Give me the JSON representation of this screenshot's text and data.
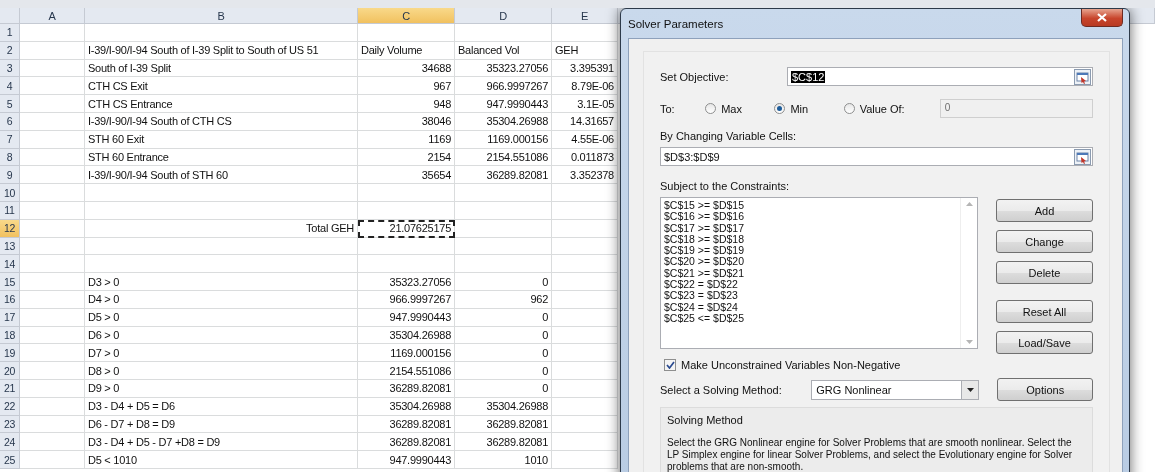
{
  "sheet": {
    "columns": [
      {
        "label": "A",
        "selected": false
      },
      {
        "label": "B",
        "selected": false
      },
      {
        "label": "C",
        "selected": true
      },
      {
        "label": "D",
        "selected": false
      },
      {
        "label": "E",
        "selected": false
      }
    ],
    "rows": [
      {
        "number": "1",
        "selected": false,
        "kind": "data",
        "cells": {}
      },
      {
        "number": "2",
        "selected": false,
        "kind": "header",
        "cells": {
          "b": "I-39/I-90/I-94 South of I-39 Split to South of US 51",
          "c": "Daily Volume",
          "d": "Balanced Vol",
          "e": "GEH"
        }
      },
      {
        "number": "3",
        "selected": false,
        "kind": "data",
        "cells": {
          "b": "South of I-39 Split",
          "c": "34688",
          "d": "35323.27056",
          "e": "3.395391"
        }
      },
      {
        "number": "4",
        "selected": false,
        "kind": "data",
        "cells": {
          "b": "CTH CS Exit",
          "c": "967",
          "d": "966.9997267",
          "e": "8.79E-06"
        }
      },
      {
        "number": "5",
        "selected": false,
        "kind": "data",
        "cells": {
          "b": "CTH CS Entrance",
          "c": "948",
          "d": "947.9990443",
          "e": "3.1E-05"
        }
      },
      {
        "number": "6",
        "selected": false,
        "kind": "data",
        "cells": {
          "b": "I-39/I-90/I-94 South of CTH CS",
          "c": "38046",
          "d": "35304.26988",
          "e": "14.31657"
        }
      },
      {
        "number": "7",
        "selected": false,
        "kind": "data",
        "cells": {
          "b": "STH 60 Exit",
          "c": "1169",
          "d": "1169.000156",
          "e": "4.55E-06"
        }
      },
      {
        "number": "8",
        "selected": false,
        "kind": "data",
        "cells": {
          "b": "STH 60 Entrance",
          "c": "2154",
          "d": "2154.551086",
          "e": "0.011873"
        }
      },
      {
        "number": "9",
        "selected": false,
        "kind": "data",
        "cells": {
          "b": "I-39/I-90/I-94 South of STH 60",
          "c": "35654",
          "d": "36289.82081",
          "e": "3.352378"
        }
      },
      {
        "number": "10",
        "selected": false,
        "kind": "data",
        "cells": {}
      },
      {
        "number": "11",
        "selected": false,
        "kind": "data",
        "cells": {}
      },
      {
        "number": "12",
        "selected": true,
        "kind": "total",
        "cells": {
          "b": "Total GEH",
          "c": "21.07625175"
        }
      },
      {
        "number": "13",
        "selected": false,
        "kind": "data",
        "cells": {}
      },
      {
        "number": "14",
        "selected": false,
        "kind": "data",
        "cells": {}
      },
      {
        "number": "15",
        "selected": false,
        "kind": "data",
        "cells": {
          "b": "D3 > 0",
          "c": "35323.27056",
          "d": "0"
        }
      },
      {
        "number": "16",
        "selected": false,
        "kind": "data",
        "cells": {
          "b": "D4 > 0",
          "c": "966.9997267",
          "d": "962"
        }
      },
      {
        "number": "17",
        "selected": false,
        "kind": "data",
        "cells": {
          "b": "D5 > 0",
          "c": "947.9990443",
          "d": "0"
        }
      },
      {
        "number": "18",
        "selected": false,
        "kind": "data",
        "cells": {
          "b": "D6 > 0",
          "c": "35304.26988",
          "d": "0"
        }
      },
      {
        "number": "19",
        "selected": false,
        "kind": "data",
        "cells": {
          "b": "D7 > 0",
          "c": "1169.000156",
          "d": "0"
        }
      },
      {
        "number": "20",
        "selected": false,
        "kind": "data",
        "cells": {
          "b": "D8 > 0",
          "c": "2154.551086",
          "d": "0"
        }
      },
      {
        "number": "21",
        "selected": false,
        "kind": "data",
        "cells": {
          "b": "D9 > 0",
          "c": "36289.82081",
          "d": "0"
        }
      },
      {
        "number": "22",
        "selected": false,
        "kind": "data",
        "cells": {
          "b": "D3 - D4 + D5 = D6",
          "c": "35304.26988",
          "d": "35304.26988"
        }
      },
      {
        "number": "23",
        "selected": false,
        "kind": "data",
        "cells": {
          "b": "D6 - D7 + D8 = D9",
          "c": "36289.82081",
          "d": "36289.82081"
        }
      },
      {
        "number": "24",
        "selected": false,
        "kind": "data",
        "cells": {
          "b": "D3 - D4 + D5 - D7 +D8 = D9",
          "c": "36289.82081",
          "d": "36289.82081"
        }
      },
      {
        "number": "25",
        "selected": false,
        "kind": "data",
        "cells": {
          "b": "D5 < 1010",
          "c": "947.9990443",
          "d": "1010"
        }
      }
    ]
  },
  "dialog": {
    "title": "Solver Parameters",
    "objective": {
      "label": "Set Objective:",
      "value": "$C$12"
    },
    "to": {
      "label": "To:",
      "options": [
        {
          "label": "Max",
          "selected": false
        },
        {
          "label": "Min",
          "selected": true
        },
        {
          "label": "Value Of:",
          "selected": false
        }
      ],
      "value_of": {
        "value": "0",
        "disabled": true
      }
    },
    "changing": {
      "label": "By Changing Variable Cells:",
      "value": "$D$3:$D$9"
    },
    "constraints": {
      "label": "Subject to the Constraints:",
      "items": [
        "$C$15 >= $D$15",
        "$C$16 >= $D$16",
        "$C$17 >= $D$17",
        "$C$18 >= $D$18",
        "$C$19 >= $D$19",
        "$C$20 >= $D$20",
        "$C$21 >= $D$21",
        "$C$22 = $D$22",
        "$C$23 = $D$23",
        "$C$24 = $D$24",
        "$C$25 <= $D$25"
      ]
    },
    "button_groups": [
      [
        "Add",
        "Change",
        "Delete"
      ],
      [
        "Reset All",
        "Load/Save"
      ]
    ],
    "nonnegative": {
      "label": "Make Unconstrained Variables Non-Negative",
      "checked": true
    },
    "method": {
      "label": "Select a Solving Method:",
      "value": "GRG Nonlinear"
    },
    "options_button": "Options",
    "solving_method": {
      "title": "Solving Method",
      "text": "Select the GRG Nonlinear engine for Solver Problems that are smooth nonlinear. Select the LP Simplex engine for linear Solver Problems, and select the Evolutionary engine for Solver problems that are non-smooth."
    }
  }
}
